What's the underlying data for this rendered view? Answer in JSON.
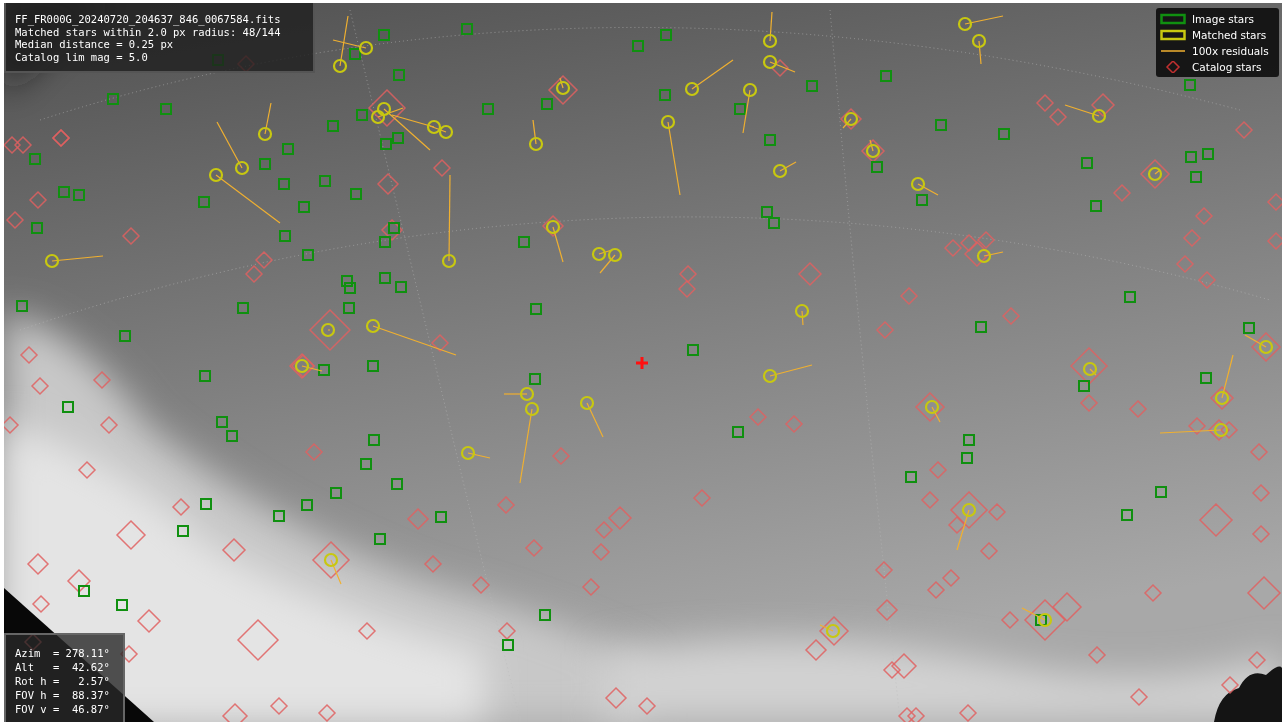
{
  "info": {
    "lines": [
      "FF_FR000G_20240720_204637_846_0067584.fits",
      "Matched stars within 2.0 px radius: 48/144",
      "Median distance = 0.25 px",
      "Catalog lim mag = 5.0"
    ]
  },
  "legend": [
    {
      "label": "Image stars"
    },
    {
      "kind": "matched",
      "label": "Matched stars"
    },
    {
      "kind": "residual",
      "label": "100x residuals"
    },
    {
      "kind": "catalog",
      "label": "Catalog stars"
    }
  ],
  "pointing": {
    "lines": [
      "Azim  = 278.11°",
      "Alt   =  42.62°",
      "Rot h =   2.57°",
      "FOV h =  88.37°",
      "FOV v =  46.87°"
    ]
  }
}
